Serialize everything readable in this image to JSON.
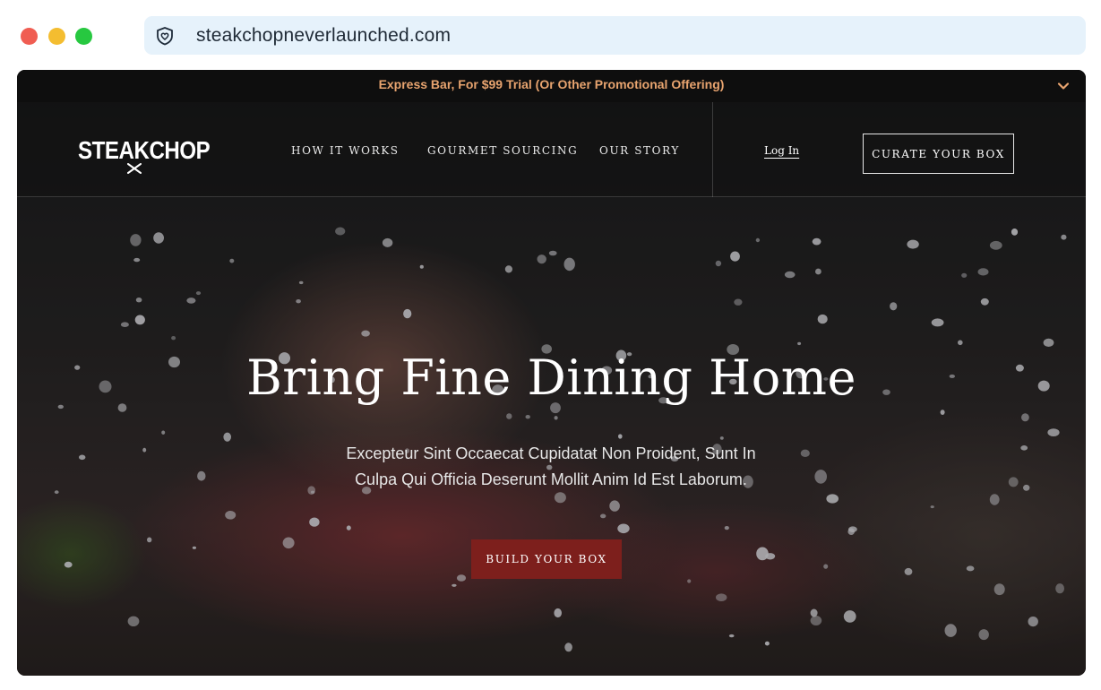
{
  "browser": {
    "url": "steakchopneverlaunched.com",
    "icons": {
      "security": "shield-heart-icon"
    },
    "window_controls": [
      "close",
      "minimize",
      "maximize"
    ]
  },
  "promo_bar": {
    "text": "Express Bar, For $99 Trial (Or Other Promotional Offering)",
    "icon": "chevron-down-icon",
    "color": "#e8a46f"
  },
  "header": {
    "logo": "STEAKCHOP",
    "nav": [
      {
        "label": "HOW IT WORKS"
      },
      {
        "label": "GOURMET SOURCING"
      },
      {
        "label": "OUR STORY"
      }
    ],
    "login": "Log In",
    "cta": "CURATE YOUR BOX"
  },
  "hero": {
    "title": "Bring Fine Dining Home",
    "subtitle_line1": "Excepteur Sint Occaecat Cupidatat Non Proident, Sunt In",
    "subtitle_line2": "Culpa Qui Officia Deserunt Mollit Anim Id Est Laborum.",
    "button": "BUILD YOUR BOX",
    "button_color": "#7d1f1c"
  }
}
